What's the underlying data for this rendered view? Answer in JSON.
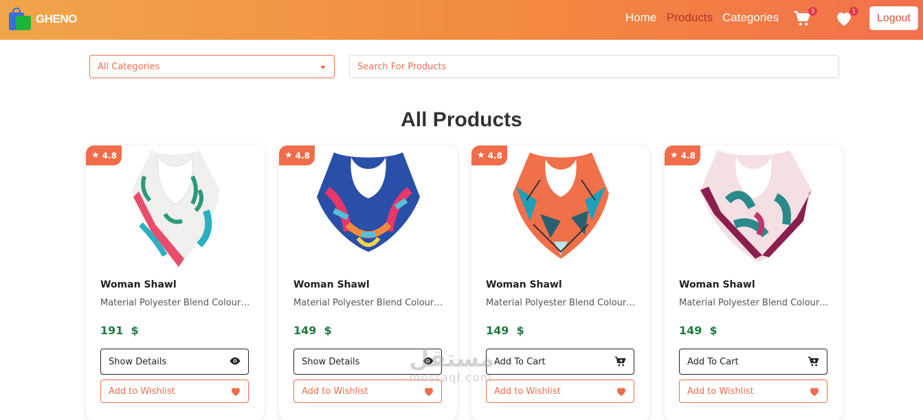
{
  "brand": {
    "name": "GHENO"
  },
  "nav": {
    "links": [
      {
        "label": "Home",
        "active": false
      },
      {
        "label": "Products",
        "active": true
      },
      {
        "label": "Categories",
        "active": false
      }
    ],
    "cart_count": "3",
    "wishlist_count": "1",
    "logout_label": "Logout"
  },
  "filters": {
    "category_selected": "All Categories",
    "search_placeholder": "Search For Products"
  },
  "section_title": "All Products",
  "products": [
    {
      "rating": "4.8",
      "title": "Woman Shawl",
      "description": "Material Polyester Blend Colour ...",
      "price": "191",
      "currency": "$",
      "primary_action": "Show Details",
      "primary_icon": "eye-icon",
      "wishlist_label": "Add to Wishlist"
    },
    {
      "rating": "4.8",
      "title": "Woman Shawl",
      "description": "Material Polyester Blend Colour ...",
      "price": "149",
      "currency": "$",
      "primary_action": "Show Details",
      "primary_icon": "eye-icon",
      "wishlist_label": "Add to Wishlist"
    },
    {
      "rating": "4.8",
      "title": "Woman Shawl",
      "description": "Material Polyester Blend Colour ...",
      "price": "149",
      "currency": "$",
      "primary_action": "Add To Cart",
      "primary_icon": "cart-icon",
      "wishlist_label": "Add to Wishlist"
    },
    {
      "rating": "4.8",
      "title": "Woman Shawl",
      "description": "Material Polyester Blend Colour ...",
      "price": "149",
      "currency": "$",
      "primary_action": "Add To Cart",
      "primary_icon": "cart-icon",
      "wishlist_label": "Add to Wishlist"
    }
  ],
  "watermark": {
    "arabic": "مستقل",
    "latin": "mostaql.com"
  },
  "colors": {
    "accent": "#ef6d4a",
    "price_green": "#1f7a3e",
    "active_nav": "#b8322a"
  }
}
